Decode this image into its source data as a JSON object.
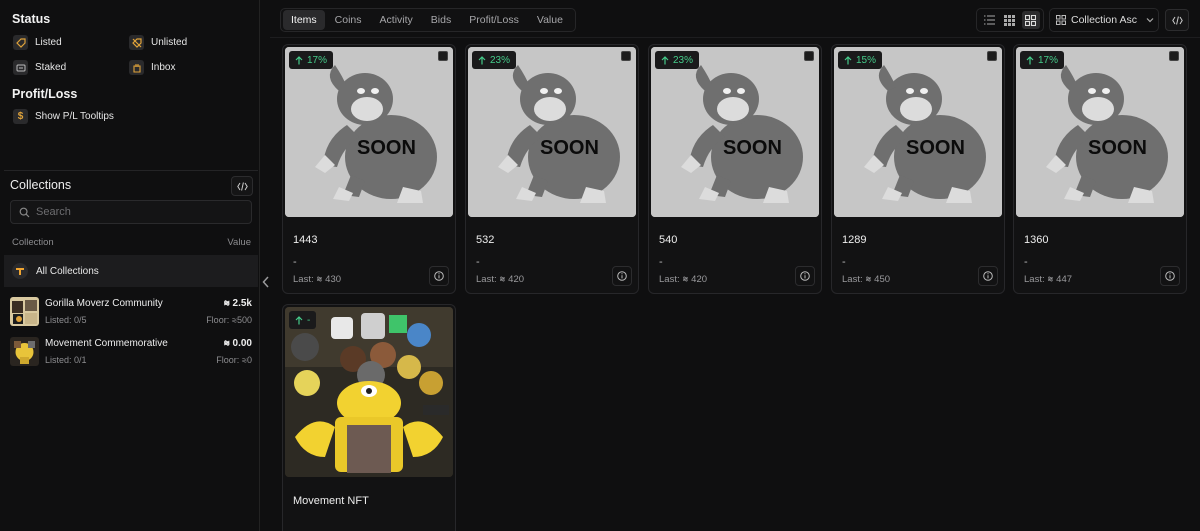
{
  "sidebar": {
    "status_title": "Status",
    "status": [
      {
        "label": "Listed",
        "icon": "tag-icon"
      },
      {
        "label": "Unlisted",
        "icon": "tag-off-icon"
      },
      {
        "label": "Staked",
        "icon": "stake-icon"
      },
      {
        "label": "Inbox",
        "icon": "inbox-icon"
      }
    ],
    "pl_title": "Profit/Loss",
    "pl_option": "Show P/L Tooltips",
    "collections_title": "Collections",
    "search_placeholder": "Search",
    "col_header_collection": "Collection",
    "col_header_value": "Value",
    "all_collections": "All Collections",
    "collections": [
      {
        "name": "Gorilla Moverz Community",
        "listed": "Listed: 0/5",
        "value": "2.5k",
        "floor": "Floor: ",
        "floor_value": "500"
      },
      {
        "name": "Movement Commemorative",
        "listed": "Listed: 0/1",
        "value": "0.00",
        "floor": "Floor: ",
        "floor_value": "0"
      }
    ]
  },
  "tabs": [
    "Items",
    "Coins",
    "Activity",
    "Bids",
    "Profit/Loss",
    "Value"
  ],
  "sort_label": "Collection Asc",
  "colors": {
    "accent_green": "#45cc8a",
    "bg": "#0f0f10"
  },
  "cards": [
    {
      "badge": "17%",
      "img_text": "SOON",
      "title": "1443",
      "dash": "-",
      "last_label": "Last:",
      "last_value": "430"
    },
    {
      "badge": "23%",
      "img_text": "SOON",
      "title": "532",
      "dash": "-",
      "last_label": "Last:",
      "last_value": "420"
    },
    {
      "badge": "23%",
      "img_text": "SOON",
      "title": "540",
      "dash": "-",
      "last_label": "Last:",
      "last_value": "420"
    },
    {
      "badge": "15%",
      "img_text": "SOON",
      "title": "1289",
      "dash": "-",
      "last_label": "Last:",
      "last_value": "450"
    },
    {
      "badge": "17%",
      "img_text": "SOON",
      "title": "1360",
      "dash": "-",
      "last_label": "Last:",
      "last_value": "447"
    },
    {
      "badge": "-",
      "title": "Movement NFT"
    }
  ]
}
